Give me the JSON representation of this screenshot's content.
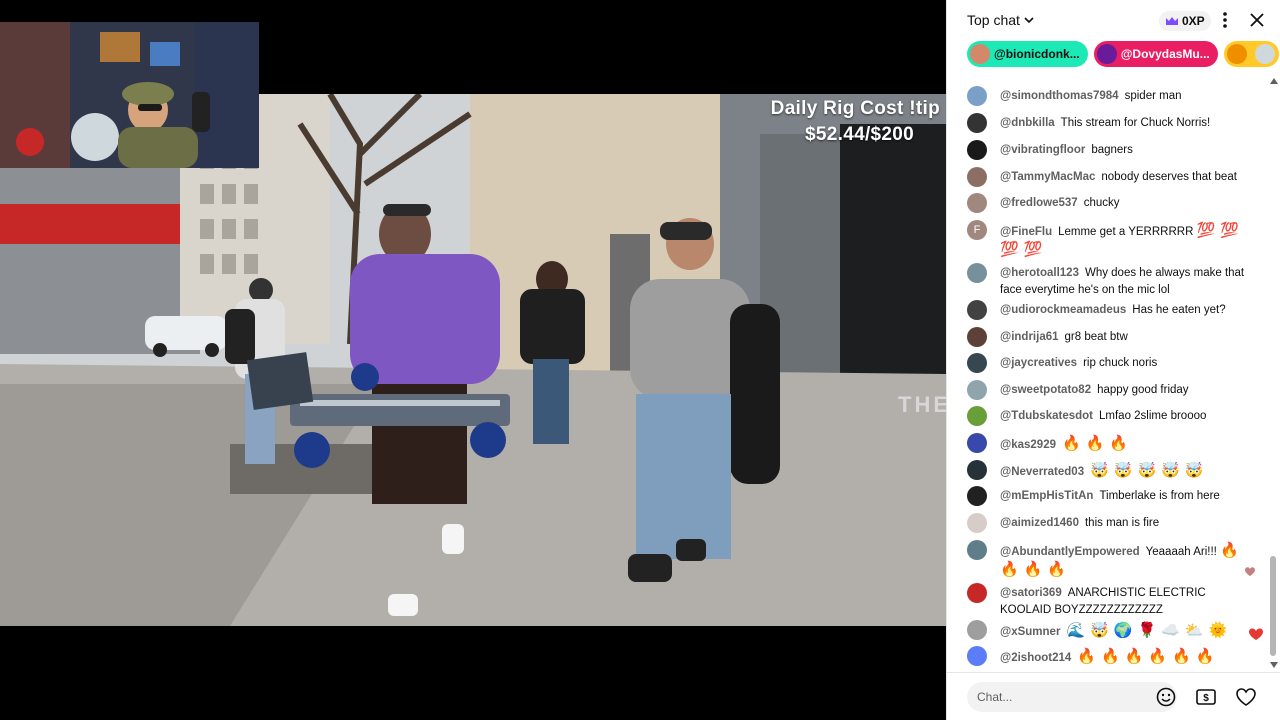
{
  "overlay": {
    "line1": "Daily Rig Cost !tip",
    "line2": "$52.44/$200",
    "storefront_text": "THE"
  },
  "chat": {
    "title": "Top chat",
    "xp": "0XP",
    "tickers": [
      {
        "name": "@bionicdonk...",
        "color": "#1de9b6",
        "text_color": "#0f0f0f"
      },
      {
        "name": "@DovydasMu...",
        "color": "#e91e63",
        "text_color": "#ffffff"
      },
      {
        "name": "",
        "color": "#ffca28",
        "text_color": "#0f0f0f"
      }
    ],
    "messages": [
      {
        "author": "@simondthomas7984",
        "text": "spider man",
        "avatar_color": "#7aa0c8"
      },
      {
        "author": "@dnbkilla",
        "text": "This stream for Chuck Norris!",
        "avatar_color": "#333333"
      },
      {
        "author": "@vibratingfloor",
        "text": "bagners",
        "avatar_color": "#1a1a1a"
      },
      {
        "author": "@TammyMacMac",
        "text": "nobody deserves that beat",
        "avatar_color": "#8d6e63"
      },
      {
        "author": "@fredlowe537",
        "text": "chucky",
        "avatar_color": "#a1887f"
      },
      {
        "author": "@FineFlu",
        "text": "Lemme get a YERRRRRR",
        "emojis": [
          "💯",
          "💯",
          "💯",
          "💯"
        ],
        "avatar_color": "#a1887f",
        "avatar_letter": "F"
      },
      {
        "author": "@herotoall123",
        "text": "Why does he always make that face everytime he's on the mic lol",
        "avatar_color": "#78909c"
      },
      {
        "author": "@udiorockmeamadeus",
        "text": "Has he eaten yet?",
        "avatar_color": "#424242"
      },
      {
        "author": "@indrija61",
        "text": "gr8 beat btw",
        "avatar_color": "#5d4037"
      },
      {
        "author": "@jaycreatives",
        "text": "rip chuck noris",
        "avatar_color": "#37474f"
      },
      {
        "author": "@sweetpotato82",
        "text": "happy good friday",
        "avatar_color": "#90a4ae"
      },
      {
        "author": "@Tdubskatesdot",
        "text": "Lmfao 2slime broooo",
        "avatar_color": "#689f38"
      },
      {
        "author": "@kas2929",
        "text": "",
        "emojis": [
          "🔥",
          "🔥",
          "🔥"
        ],
        "avatar_color": "#3949ab"
      },
      {
        "author": "@Neverrated03",
        "text": "",
        "emojis": [
          "🤯",
          "🤯",
          "🤯",
          "🤯",
          "🤯"
        ],
        "avatar_color": "#263238"
      },
      {
        "author": "@mEmpHisTitAn",
        "text": "Timberlake is from here",
        "avatar_color": "#212121"
      },
      {
        "author": "@aimized1460",
        "text": "this man is fire",
        "avatar_color": "#d7ccc8"
      },
      {
        "author": "@AbundantlyEmpowered",
        "text": "Yeaaaah Ari!!!",
        "emojis": [
          "🔥",
          "🔥",
          "🔥",
          "🔥"
        ],
        "avatar_color": "#607d8b"
      },
      {
        "author": "@satori369",
        "text": "ANARCHISTIC ELECTRIC KOOLAID BOYZZZZZZZZZZZZ",
        "avatar_color": "#c62828"
      },
      {
        "author": "@xSumner",
        "text": "",
        "emojis": [
          "🌊",
          "🤯",
          "🌍",
          "🌹",
          "☁️",
          "⛅",
          "🌞"
        ],
        "avatar_color": "#9e9e9e"
      },
      {
        "author": "@2ishoot214",
        "text": "",
        "emojis": [
          "🔥",
          "🔥",
          "🔥",
          "🔥",
          "🔥",
          "🔥"
        ],
        "avatar_color": "#5c7cfa"
      }
    ],
    "input_placeholder": "Chat..."
  }
}
